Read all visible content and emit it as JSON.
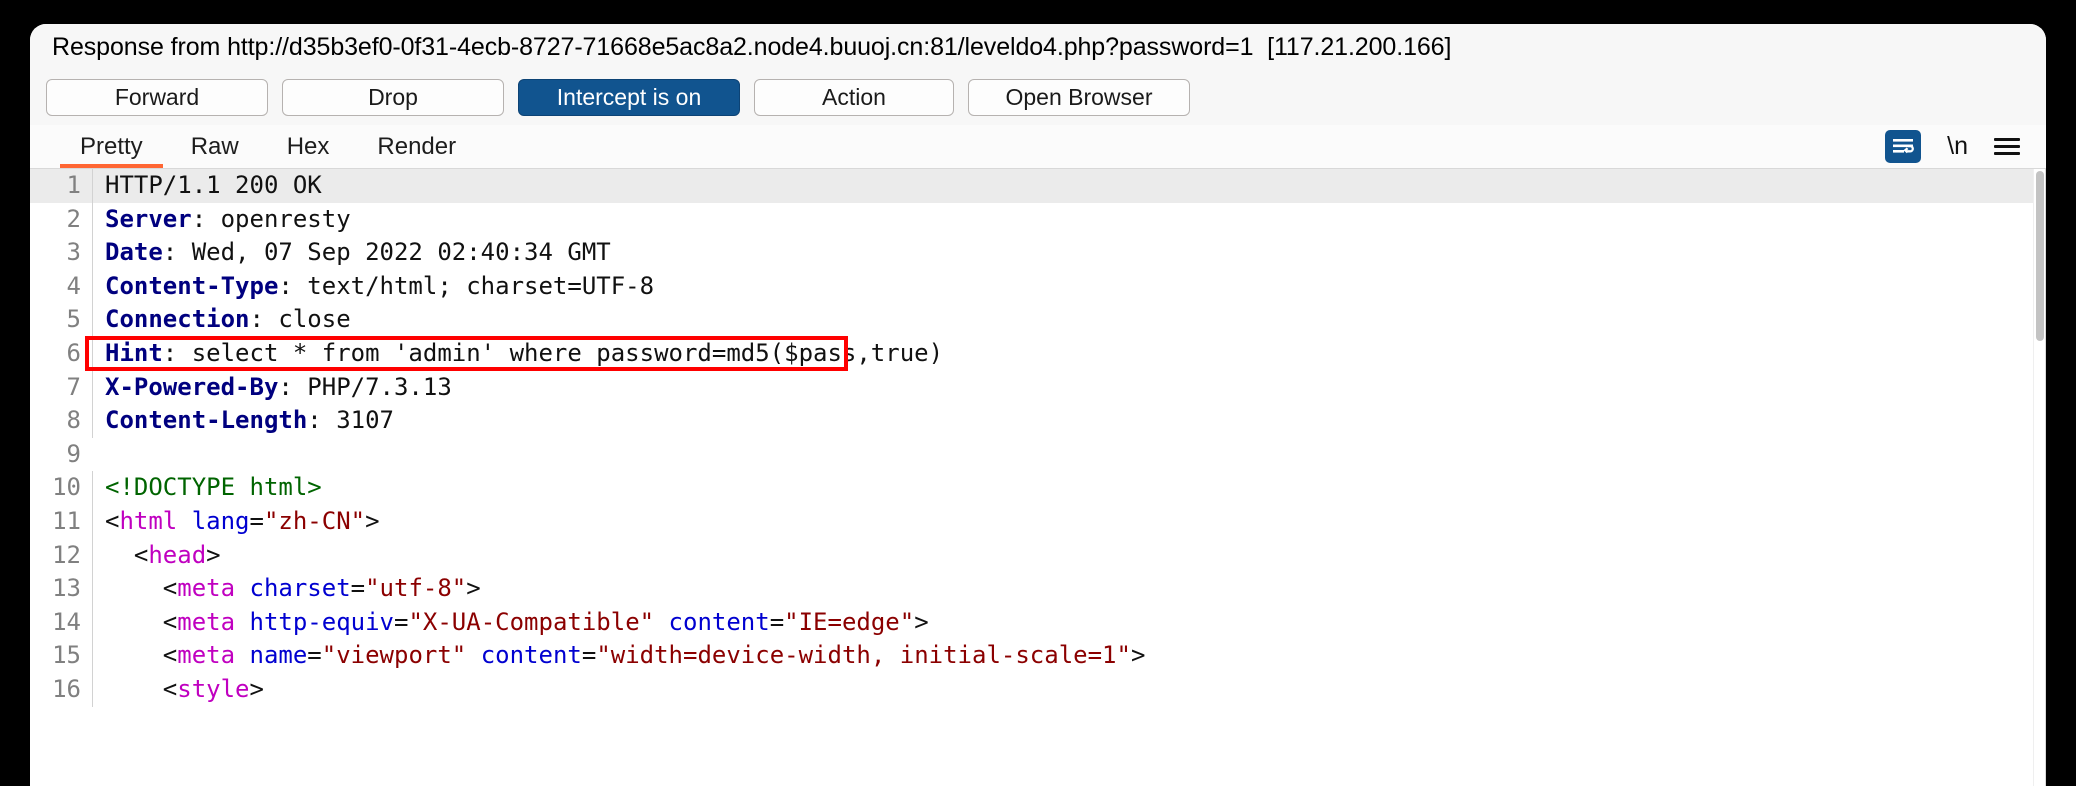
{
  "window": {
    "title": "Response from http://d35b3ef0-0f31-4ecb-8727-71668e5ac8a2.node4.buuoj.cn:81/leveldo4.php?password=1  [117.21.200.166]"
  },
  "toolbar": {
    "forward_label": "Forward",
    "drop_label": "Drop",
    "intercept_label": "Intercept is on",
    "action_label": "Action",
    "open_browser_label": "Open Browser",
    "primary_color": "#11548f"
  },
  "tabs": {
    "items": [
      {
        "label": "Pretty",
        "active": true
      },
      {
        "label": "Raw",
        "active": false
      },
      {
        "label": "Hex",
        "active": false
      },
      {
        "label": "Render",
        "active": false
      }
    ],
    "active_underline_color": "#ff6633",
    "tools": {
      "wrap_icon": "word-wrap-icon",
      "newline_label": "\\n",
      "menu_icon": "hamburger-menu-icon"
    }
  },
  "annotation": {
    "color": "#ff0000",
    "target_line": 6,
    "shape": "rectangle"
  },
  "code": {
    "lines": [
      {
        "n": "1",
        "highlight": true,
        "segments": [
          {
            "t": "HTTP/1.1 200 OK",
            "c": "val"
          }
        ]
      },
      {
        "n": "2",
        "highlight": false,
        "segments": [
          {
            "t": "Server",
            "c": "hdr"
          },
          {
            "t": ": openresty",
            "c": "val"
          }
        ]
      },
      {
        "n": "3",
        "highlight": false,
        "segments": [
          {
            "t": "Date",
            "c": "hdr"
          },
          {
            "t": ": Wed, 07 Sep 2022 02:40:34 GMT",
            "c": "val"
          }
        ]
      },
      {
        "n": "4",
        "highlight": false,
        "segments": [
          {
            "t": "Content-Type",
            "c": "hdr"
          },
          {
            "t": ": text/html; charset=UTF-8",
            "c": "val"
          }
        ]
      },
      {
        "n": "5",
        "highlight": false,
        "segments": [
          {
            "t": "Connection",
            "c": "hdr"
          },
          {
            "t": ": close",
            "c": "val"
          }
        ]
      },
      {
        "n": "6",
        "highlight": false,
        "segments": [
          {
            "t": "Hint",
            "c": "hdr"
          },
          {
            "t": ": select * from 'admin' where password=md5($pass,true)",
            "c": "val"
          }
        ]
      },
      {
        "n": "7",
        "highlight": false,
        "segments": [
          {
            "t": "X-Powered-By",
            "c": "hdr"
          },
          {
            "t": ": PHP/7.3.13",
            "c": "val"
          }
        ]
      },
      {
        "n": "8",
        "highlight": false,
        "segments": [
          {
            "t": "Content-Length",
            "c": "hdr"
          },
          {
            "t": ": 3107",
            "c": "val"
          }
        ]
      },
      {
        "n": "9",
        "highlight": false,
        "segments": [
          {
            "t": "",
            "c": "val"
          }
        ]
      },
      {
        "n": "10",
        "highlight": false,
        "segments": [
          {
            "t": "<!DOCTYPE html>",
            "c": "doct"
          }
        ]
      },
      {
        "n": "11",
        "highlight": false,
        "segments": [
          {
            "t": "<",
            "c": "punc"
          },
          {
            "t": "html",
            "c": "tag"
          },
          {
            "t": " ",
            "c": "punc"
          },
          {
            "t": "lang",
            "c": "attr"
          },
          {
            "t": "=",
            "c": "punc"
          },
          {
            "t": "\"zh-CN\"",
            "c": "str"
          },
          {
            "t": ">",
            "c": "punc"
          }
        ]
      },
      {
        "n": "12",
        "highlight": false,
        "segments": [
          {
            "t": "  <",
            "c": "punc"
          },
          {
            "t": "head",
            "c": "tag"
          },
          {
            "t": ">",
            "c": "punc"
          }
        ]
      },
      {
        "n": "13",
        "highlight": false,
        "segments": [
          {
            "t": "    <",
            "c": "punc"
          },
          {
            "t": "meta",
            "c": "tag"
          },
          {
            "t": " ",
            "c": "punc"
          },
          {
            "t": "charset",
            "c": "attr"
          },
          {
            "t": "=",
            "c": "punc"
          },
          {
            "t": "\"utf-8\"",
            "c": "str"
          },
          {
            "t": ">",
            "c": "punc"
          }
        ]
      },
      {
        "n": "14",
        "highlight": false,
        "segments": [
          {
            "t": "    <",
            "c": "punc"
          },
          {
            "t": "meta",
            "c": "tag"
          },
          {
            "t": " ",
            "c": "punc"
          },
          {
            "t": "http-equiv",
            "c": "attr"
          },
          {
            "t": "=",
            "c": "punc"
          },
          {
            "t": "\"X-UA-Compatible\"",
            "c": "str"
          },
          {
            "t": " ",
            "c": "punc"
          },
          {
            "t": "content",
            "c": "attr"
          },
          {
            "t": "=",
            "c": "punc"
          },
          {
            "t": "\"IE=edge\"",
            "c": "str"
          },
          {
            "t": ">",
            "c": "punc"
          }
        ]
      },
      {
        "n": "15",
        "highlight": false,
        "segments": [
          {
            "t": "    <",
            "c": "punc"
          },
          {
            "t": "meta",
            "c": "tag"
          },
          {
            "t": " ",
            "c": "punc"
          },
          {
            "t": "name",
            "c": "attr"
          },
          {
            "t": "=",
            "c": "punc"
          },
          {
            "t": "\"viewport\"",
            "c": "str"
          },
          {
            "t": " ",
            "c": "punc"
          },
          {
            "t": "content",
            "c": "attr"
          },
          {
            "t": "=",
            "c": "punc"
          },
          {
            "t": "\"width=device-width, initial-scale=1\"",
            "c": "str"
          },
          {
            "t": ">",
            "c": "punc"
          }
        ]
      },
      {
        "n": "16",
        "highlight": false,
        "segments": [
          {
            "t": "    <",
            "c": "punc"
          },
          {
            "t": "style",
            "c": "tag"
          },
          {
            "t": ">",
            "c": "punc"
          }
        ]
      }
    ]
  }
}
